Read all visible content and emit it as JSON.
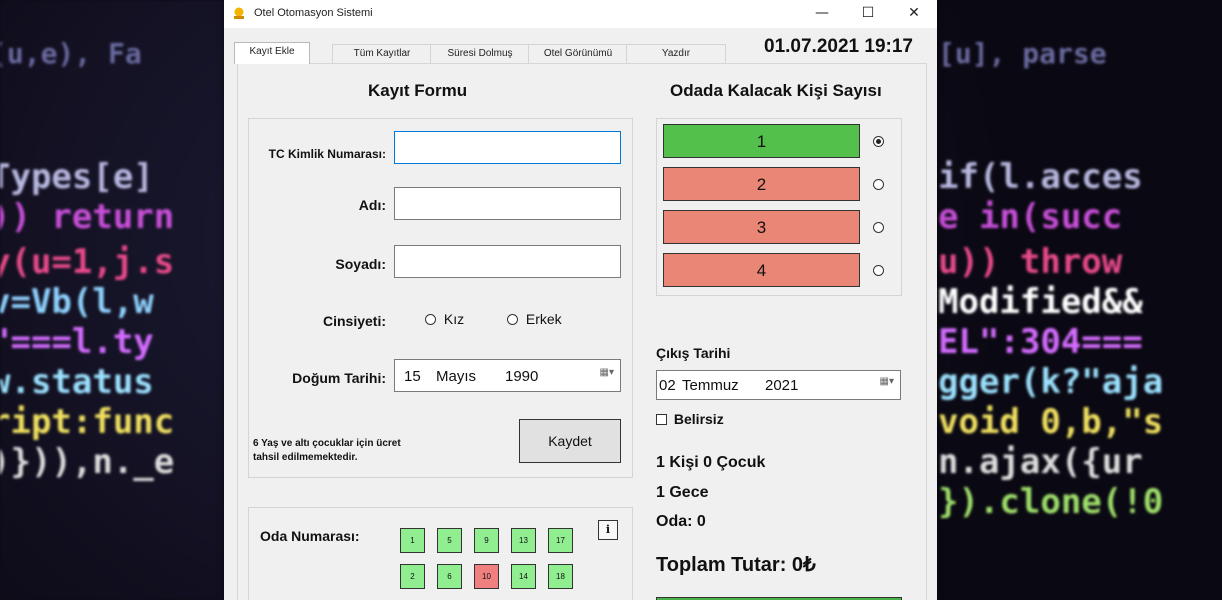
{
  "window": {
    "title": "Otel Otomasyon Sistemi",
    "controls": {
      "minimize": "—",
      "maximize": "☐",
      "close": "✕"
    }
  },
  "tabs": [
    {
      "label": "Kayıt Ekle"
    },
    {
      "label": "Tüm Kayıtlar"
    },
    {
      "label": "Süresi Dolmuş"
    },
    {
      "label": "Otel Görünümü"
    },
    {
      "label": "Yazdır"
    }
  ],
  "datetime": "01.07.2021 19:17",
  "form": {
    "title": "Kayıt Formu",
    "tc_label": "TC Kimlik Numarası:",
    "tc_value": "",
    "name_label": "Adı:",
    "name_value": "",
    "surname_label": "Soyadı:",
    "surname_value": "",
    "gender_label": "Cinsiyeti:",
    "gender_options": [
      "Kız",
      "Erkek"
    ],
    "birth_label": "Doğum Tarihi:",
    "birth_day": "15",
    "birth_month": "Mayıs",
    "birth_year": "1990",
    "note_line1": "6 Yaş ve altı çocuklar için ücret",
    "note_line2": "tahsil edilmemektedir.",
    "save_label": "Kaydet"
  },
  "rooms": {
    "label": "Oda Numarası:",
    "info_label": "i",
    "row1": [
      {
        "number": "1",
        "status": "free"
      },
      {
        "number": "5",
        "status": "free"
      },
      {
        "number": "9",
        "status": "free"
      },
      {
        "number": "13",
        "status": "free"
      },
      {
        "number": "17",
        "status": "free"
      }
    ],
    "row2": [
      {
        "number": "2",
        "status": "free"
      },
      {
        "number": "6",
        "status": "free"
      },
      {
        "number": "10",
        "status": "busy"
      },
      {
        "number": "14",
        "status": "free"
      },
      {
        "number": "18",
        "status": "free"
      }
    ]
  },
  "persons": {
    "title": "Odada Kalacak Kişi Sayısı",
    "options": [
      {
        "label": "1",
        "selected": true
      },
      {
        "label": "2",
        "selected": false
      },
      {
        "label": "3",
        "selected": false
      },
      {
        "label": "4",
        "selected": false
      }
    ],
    "colors": {
      "selected": "#53c04b",
      "unselected": "#ea8675"
    }
  },
  "checkout": {
    "label": "Çıkış Tarihi",
    "day": "02",
    "month": "Temmuz",
    "year": "2021",
    "undetermined_label": "Belirsiz"
  },
  "summary": {
    "people": "1 Kişi 0 Çocuk",
    "nights": "1 Gece",
    "room": "Oda: 0",
    "total": "Toplam Tutar: 0₺"
  }
}
